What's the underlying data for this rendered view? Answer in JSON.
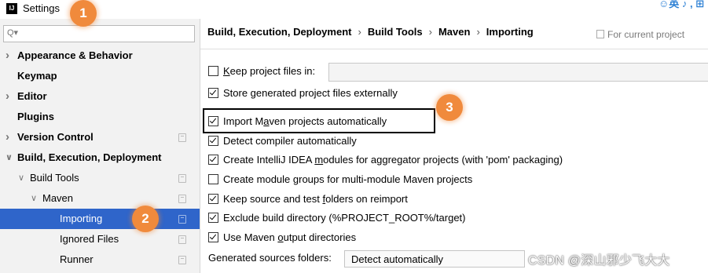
{
  "window": {
    "title": "Settings",
    "app_icon": "intellij-logo-icon"
  },
  "search": {
    "placeholder": "Q▾",
    "icon": "search-icon"
  },
  "sidebar": {
    "items": [
      {
        "label": "Appearance & Behavior",
        "bold": true,
        "arrow": "collapsed"
      },
      {
        "label": "Keymap",
        "bold": true
      },
      {
        "label": "Editor",
        "bold": true,
        "arrow": "collapsed"
      },
      {
        "label": "Plugins",
        "bold": true
      },
      {
        "label": "Version Control",
        "bold": true,
        "arrow": "collapsed"
      },
      {
        "label": "Build, Execution, Deployment",
        "bold": true,
        "arrow": "expanded"
      },
      {
        "label": "Build Tools",
        "arrow": "expanded"
      },
      {
        "label": "Maven",
        "arrow": "expanded"
      },
      {
        "label": "Importing",
        "selected": true
      },
      {
        "label": "Ignored Files"
      },
      {
        "label": "Runner"
      }
    ]
  },
  "breadcrumb": {
    "parts": [
      "Build, Execution, Deployment",
      "Build Tools",
      "Maven",
      "Importing"
    ],
    "separator": "›"
  },
  "scope_note": "For current project",
  "options": [
    {
      "pre": "",
      "u": "K",
      "post": "eep project files in:",
      "checked": false
    },
    {
      "pre": "Store generated project files externally",
      "u": "",
      "post": "",
      "checked": true
    },
    {
      "pre": "Import M",
      "u": "a",
      "post": "ven projects automatically",
      "checked": true
    },
    {
      "pre": "Detect compiler automatically",
      "u": "",
      "post": "",
      "checked": true
    },
    {
      "pre": "Create IntelliJ IDEA ",
      "u": "m",
      "post": "odules for aggregator projects (with 'pom' packaging)",
      "checked": true
    },
    {
      "pre": "Create module ",
      "u": "g",
      "post": "roups for multi-module Maven projects",
      "checked": false
    },
    {
      "pre": "Keep source and test ",
      "u": "f",
      "post": "olders on reimport",
      "checked": true
    },
    {
      "pre": "Exclude build directory (%PROJECT_ROOT%/target)",
      "u": "",
      "post": "",
      "checked": true
    },
    {
      "pre": "Use Maven ",
      "u": "o",
      "post": "utput directories",
      "checked": true
    }
  ],
  "generated_sources": {
    "label": "Generated sources folders:",
    "value": "Detect automatically"
  },
  "badges": {
    "one": "1",
    "two": "2",
    "three": "3"
  },
  "corner_widget": "☺英 ♪ , ⊞",
  "watermark": "CSDN @深山邪少飞大大",
  "colors": {
    "selection": "#2f65ca",
    "badge": "#f08a3c",
    "sidebar_bg": "#f2f2f2"
  }
}
